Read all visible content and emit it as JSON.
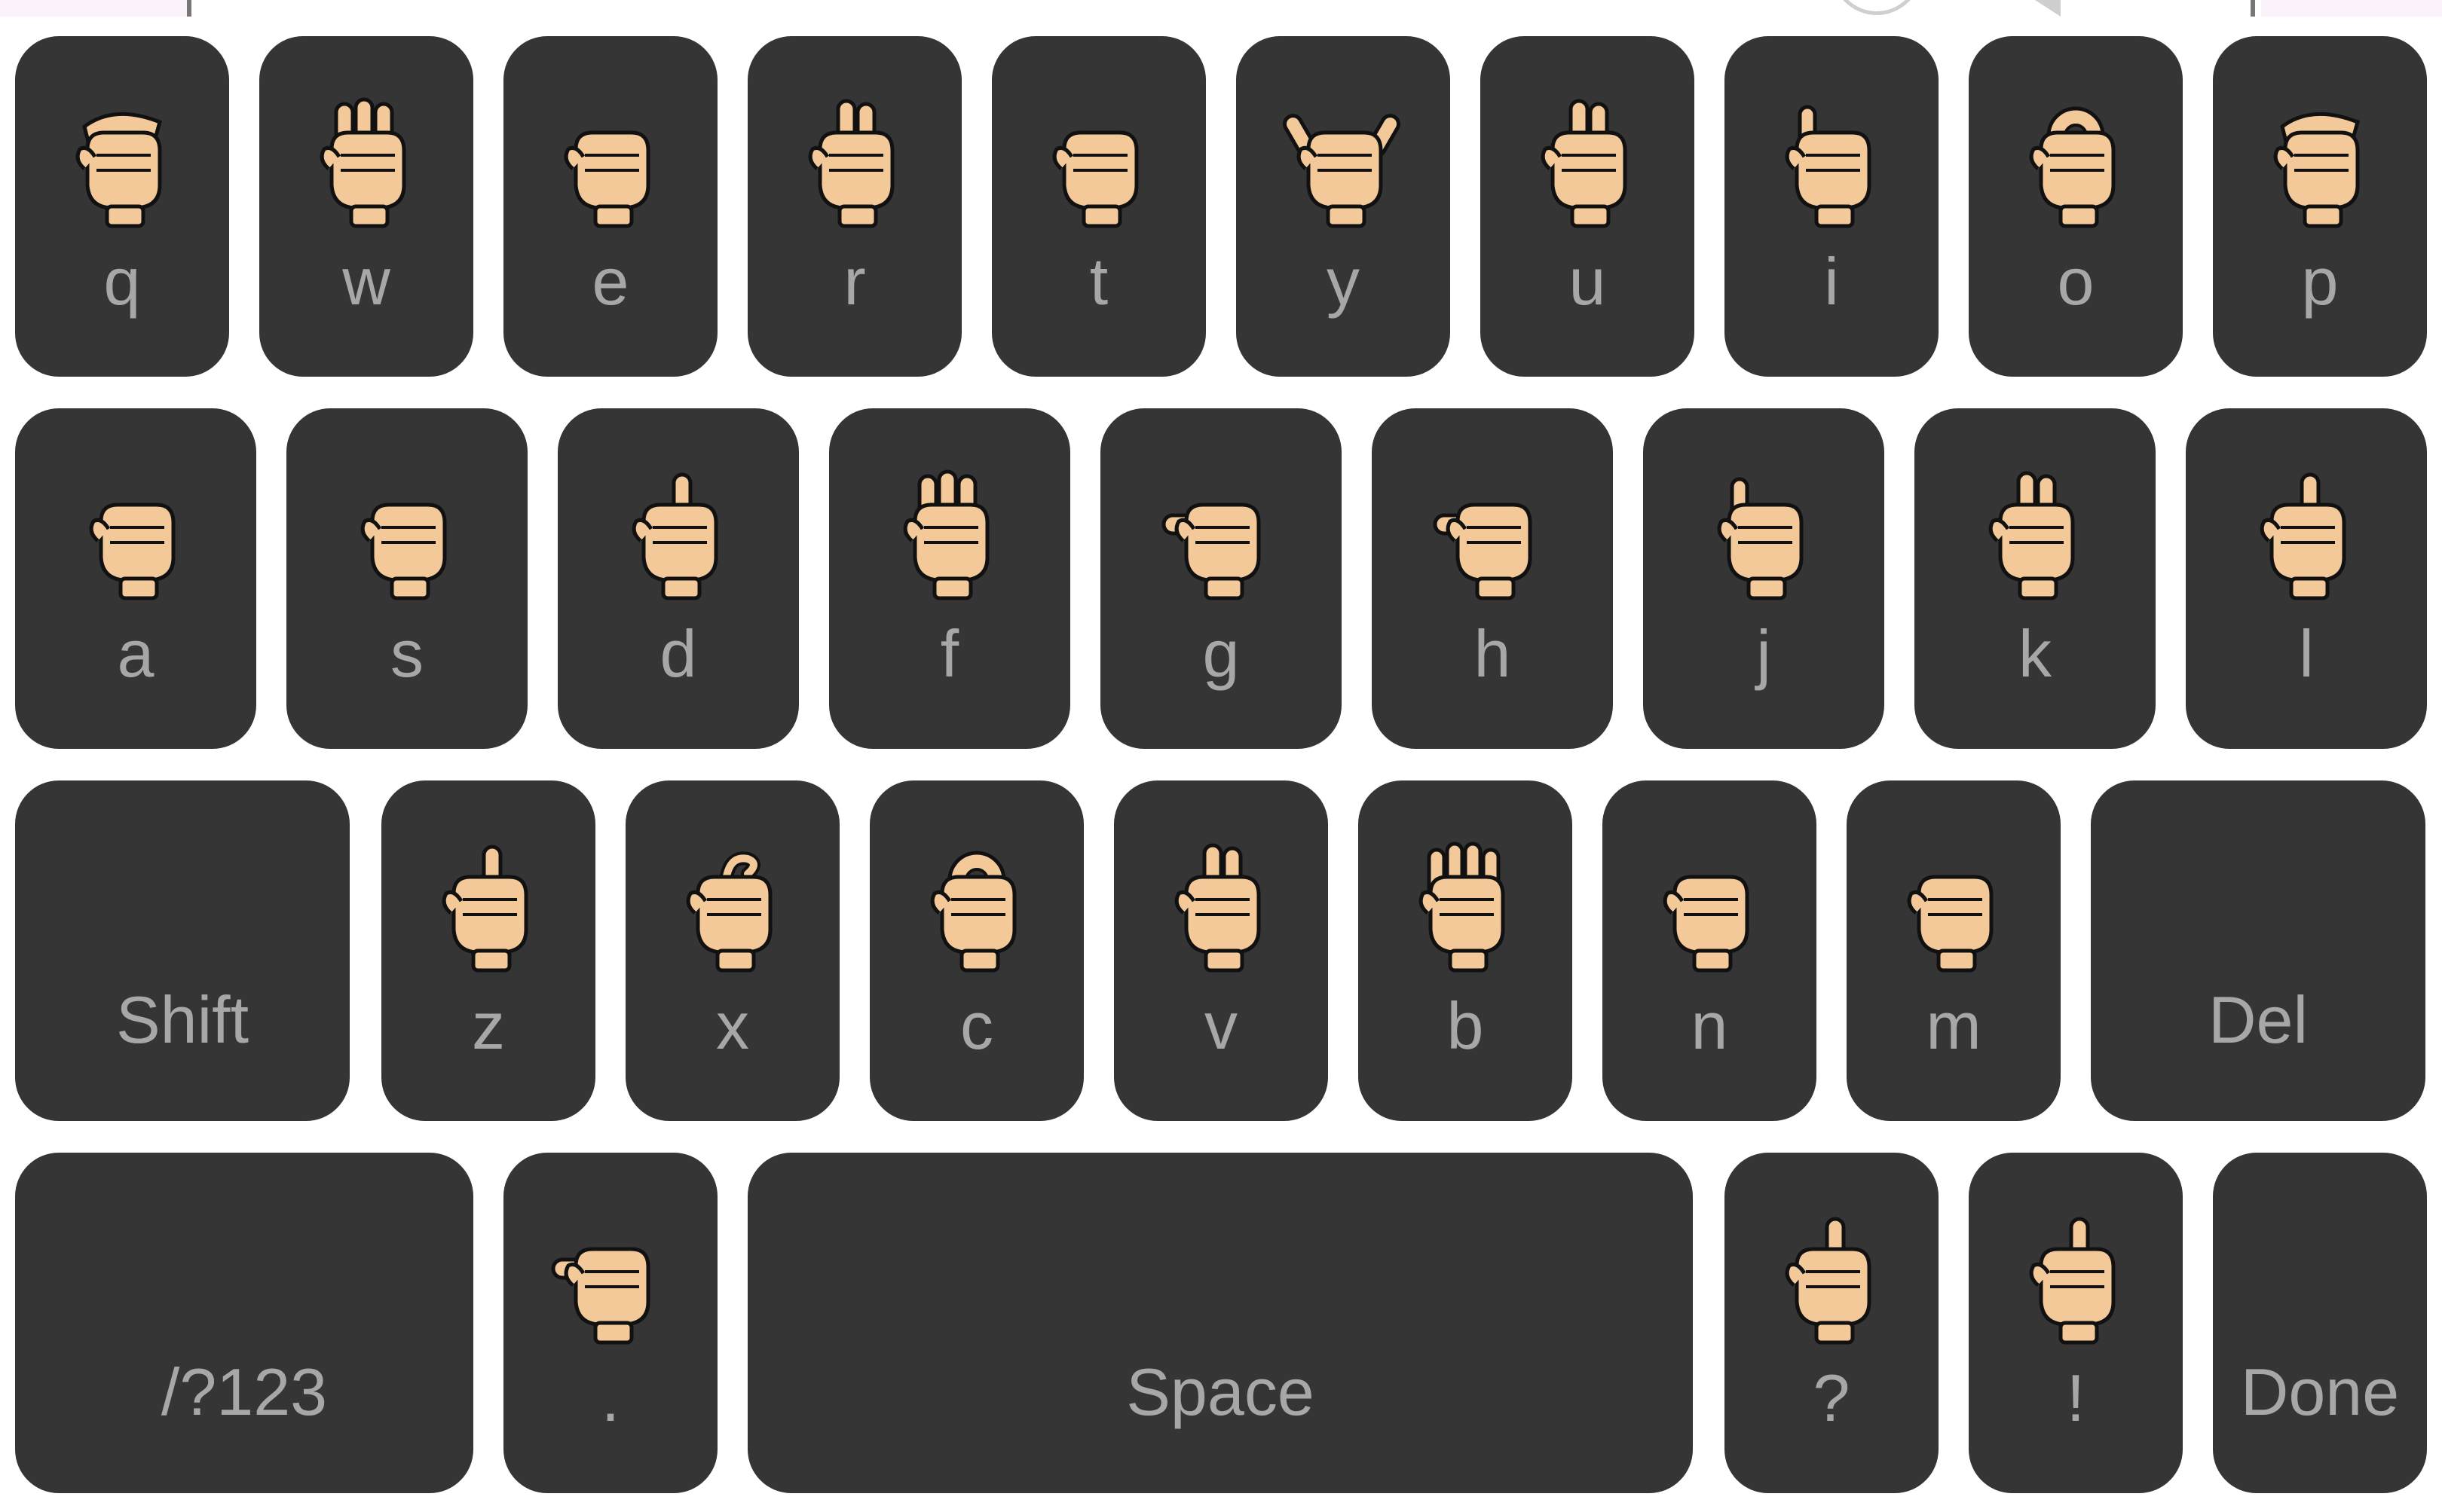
{
  "keyboard": {
    "rows": [
      [
        {
          "label": "q",
          "icon": "asl-q-hand-icon"
        },
        {
          "label": "w",
          "icon": "asl-w-hand-icon"
        },
        {
          "label": "e",
          "icon": "asl-e-hand-icon"
        },
        {
          "label": "r",
          "icon": "asl-r-hand-icon"
        },
        {
          "label": "t",
          "icon": "asl-t-hand-icon"
        },
        {
          "label": "y",
          "icon": "asl-y-hand-icon"
        },
        {
          "label": "u",
          "icon": "asl-u-hand-icon"
        },
        {
          "label": "i",
          "icon": "asl-i-hand-icon"
        },
        {
          "label": "o",
          "icon": "asl-o-hand-icon"
        },
        {
          "label": "p",
          "icon": "asl-p-hand-icon"
        }
      ],
      [
        {
          "label": "a",
          "icon": "asl-a-hand-icon"
        },
        {
          "label": "s",
          "icon": "asl-s-hand-icon"
        },
        {
          "label": "d",
          "icon": "asl-d-hand-icon"
        },
        {
          "label": "f",
          "icon": "asl-f-hand-icon"
        },
        {
          "label": "g",
          "icon": "asl-g-hand-icon"
        },
        {
          "label": "h",
          "icon": "asl-h-hand-icon"
        },
        {
          "label": "j",
          "icon": "asl-j-hand-icon"
        },
        {
          "label": "k",
          "icon": "asl-k-hand-icon"
        },
        {
          "label": "l",
          "icon": "asl-l-hand-icon"
        }
      ],
      [
        {
          "label": "Shift",
          "icon": ""
        },
        {
          "label": "z",
          "icon": "asl-z-hand-icon"
        },
        {
          "label": "x",
          "icon": "asl-x-hand-icon"
        },
        {
          "label": "c",
          "icon": "asl-c-hand-icon"
        },
        {
          "label": "v",
          "icon": "asl-v-hand-icon"
        },
        {
          "label": "b",
          "icon": "asl-b-hand-icon"
        },
        {
          "label": "n",
          "icon": "asl-n-hand-icon"
        },
        {
          "label": "m",
          "icon": "asl-m-hand-icon"
        },
        {
          "label": "Del",
          "icon": ""
        }
      ],
      [
        {
          "label": "/?123",
          "icon": ""
        },
        {
          "label": ".",
          "icon": "asl-period-hand-icon"
        },
        {
          "label": "Space",
          "icon": ""
        },
        {
          "label": "?",
          "icon": "asl-question-hand-icon"
        },
        {
          "label": "!",
          "icon": "asl-exclamation-hand-icon"
        },
        {
          "label": "Done",
          "icon": ""
        }
      ]
    ]
  },
  "colors": {
    "key_background": "#353535",
    "key_label": "#a7a7a7",
    "hand_skin": "#f3c99a",
    "hand_outline": "#111111",
    "page_background": "#ffffff"
  }
}
